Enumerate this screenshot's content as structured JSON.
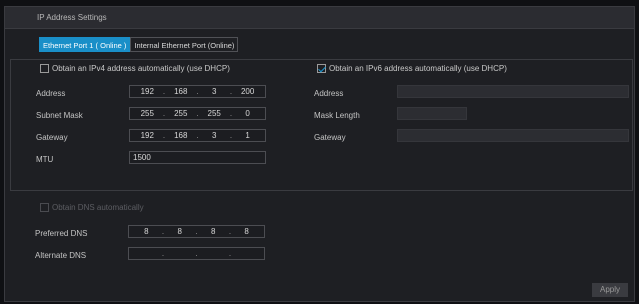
{
  "window": {
    "title": "IP Address Settings"
  },
  "tabs": [
    {
      "label": "Ethernet Port 1 ( Online )",
      "active": true
    },
    {
      "label": "Internal Ethernet Port (Online)",
      "active": false
    }
  ],
  "ipv4": {
    "dhcp_label": "Obtain an IPv4 address automatically (use DHCP)",
    "dhcp_checked": false,
    "address_label": "Address",
    "address": [
      "192",
      "168",
      "3",
      "200"
    ],
    "subnet_label": "Subnet Mask",
    "subnet": [
      "255",
      "255",
      "255",
      "0"
    ],
    "gateway_label": "Gateway",
    "gateway": [
      "192",
      "168",
      "3",
      "1"
    ],
    "mtu_label": "MTU",
    "mtu": "1500"
  },
  "ipv6": {
    "dhcp_label": "Obtain an IPv6 address automatically (use DHCP)",
    "dhcp_checked": true,
    "address_label": "Address",
    "mask_label": "Mask Length",
    "gateway_label": "Gateway"
  },
  "dns": {
    "auto_label": "Obtain DNS automatically",
    "auto_checked": false,
    "preferred_label": "Preferred DNS",
    "preferred": [
      "8",
      "8",
      "8",
      "8"
    ],
    "alternate_label": "Alternate DNS",
    "alternate": [
      "",
      "",
      "",
      ""
    ]
  },
  "actions": {
    "apply_label": "Apply"
  },
  "colors": {
    "accent": "#1a8fc8",
    "background": "#1e1f23"
  }
}
